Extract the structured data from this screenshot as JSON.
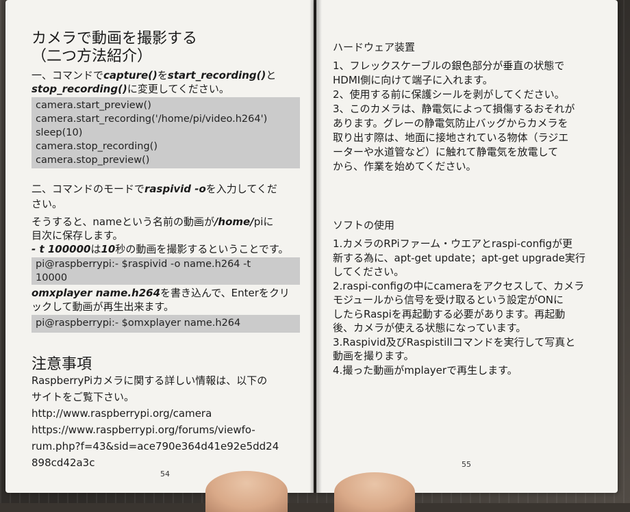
{
  "left": {
    "title_line1": "カメラで動画を撮影する",
    "title_line2": "（二つ方法紹介）",
    "s1_line1_a": "一、コマンドで",
    "s1_line1_b": "capture()",
    "s1_line1_c": "を",
    "s1_line1_d": "start_recording()",
    "s1_line1_e": "と",
    "s1_line2_a": "stop_recording()",
    "s1_line2_b": "に変更してください。",
    "code1": [
      "camera.start_preview()",
      "camera.start_recording('/home/pi/video.h264')",
      "sleep(10)",
      "camera.stop_recording()",
      "camera.stop_preview()"
    ],
    "s2_line1_a": "二、コマンドのモードで",
    "s2_line1_b": "raspivid -o",
    "s2_line1_c": "を入力してくだ",
    "s2_line2": "さい。",
    "s2_line3_a": "そうすると、nameという名前の動画が",
    "s2_line3_b": "/home/",
    "s2_line3_c": "piに",
    "s2_line4": "目次に保存します。",
    "s2_line5_a": "- t 100000",
    "s2_line5_b": "は",
    "s2_line5_c": "10",
    "s2_line5_d": "秒の動画を撮影するということです。",
    "code2": [
      "pi@raspberrypi:- $raspivid -o name.h264 -t",
      "10000"
    ],
    "s2_line6_a": "omxplayer name.h264",
    "s2_line6_b": "を書き込んで、Enterをクリ",
    "s2_line7": "ックして動画が再生出来ます。",
    "code3": [
      "pi@raspberrypi:- $omxplayer name.h264"
    ],
    "note_title": "注意事項",
    "note_lines": [
      "RaspberryPiカメラに関する詳しい情報は、以下の",
      "サイトをご覧下さい。",
      "http://www.raspberrypi.org/camera",
      "https://www.raspberrypi.org/forums/viewfo-",
      "rum.php?f=43&sid=ace790e364d41e92e5dd24",
      "898cd42a3c"
    ],
    "page_number": "54"
  },
  "right": {
    "hw_title": "ハードウェア装置",
    "hw_lines": [
      "1、フレックスケーブルの銀色部分が垂直の状態で",
      "HDMI側に向けて端子に入れます。",
      "2、使用する前に保護シールを剥がしてください。",
      "3、このカメラは、静電気によって損傷するおそれが",
      "あります。グレーの静電気防止バッグからカメラを",
      "取り出す際は、地面に接地されている物体（ラジエ",
      "ーターや水道管など）に触れて静電気を放電して",
      "から、作業を始めてください。"
    ],
    "sw_title": "ソフトの使用",
    "sw_lines": [
      "1.カメラのRPiファーム・ウエアとraspi-configが更",
      "新する為に、apt-get update；apt-get upgrade実行",
      "してください。",
      "2.raspi-configの中にcameraをアクセスして、カメラ",
      "モジュールから信号を受け取るという設定がONに",
      "したらRaspiを再起動する必要があります。再起動",
      "後、カメラが使える状態になっています。",
      "3.Raspivid及びRaspistillコマンドを実行して写真と",
      "動画を撮ります。",
      "4.撮った動画がmplayerで再生します。"
    ],
    "page_number": "55"
  }
}
